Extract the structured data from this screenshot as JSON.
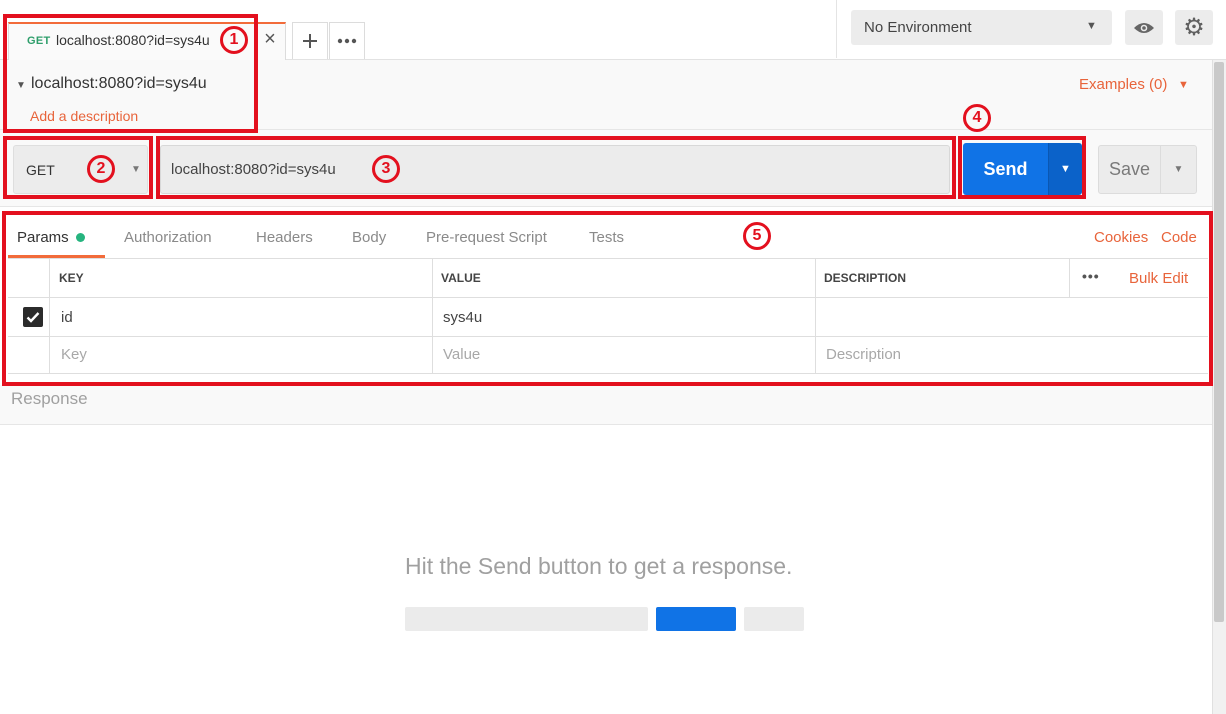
{
  "tab": {
    "method": "GET",
    "title": "localhost:8080?id=sys4u"
  },
  "environment": {
    "selected": "No Environment"
  },
  "request": {
    "name": "localhost:8080?id=sys4u",
    "add_description": "Add a description",
    "examples": "Examples (0)",
    "method": "GET",
    "url": "localhost:8080?id=sys4u",
    "send_label": "Send",
    "save_label": "Save"
  },
  "param_tabs": {
    "params": "Params",
    "authorization": "Authorization",
    "headers": "Headers",
    "body": "Body",
    "prerequest": "Pre-request Script",
    "tests": "Tests",
    "cookies": "Cookies",
    "code": "Code"
  },
  "params_table": {
    "headers": {
      "key": "KEY",
      "value": "VALUE",
      "description": "DESCRIPTION",
      "bulk_edit": "Bulk Edit"
    },
    "rows": [
      {
        "key": "id",
        "value": "sys4u",
        "description": "",
        "checked": true
      }
    ],
    "placeholder": {
      "key": "Key",
      "value": "Value",
      "description": "Description"
    }
  },
  "response": {
    "label": "Response",
    "hint": "Hit the Send button to get a response."
  },
  "annotations": [
    "1",
    "2",
    "3",
    "4",
    "5"
  ],
  "colors": {
    "accent": "#f26b3a",
    "send_blue": "#1073e6",
    "annotation_red": "#e3101e",
    "get_green": "#2e9e6b"
  },
  "icons": [
    "close-icon",
    "plus-icon",
    "more-icon",
    "caret-down-icon",
    "eye-icon",
    "gear-icon",
    "checkmark-icon"
  ]
}
